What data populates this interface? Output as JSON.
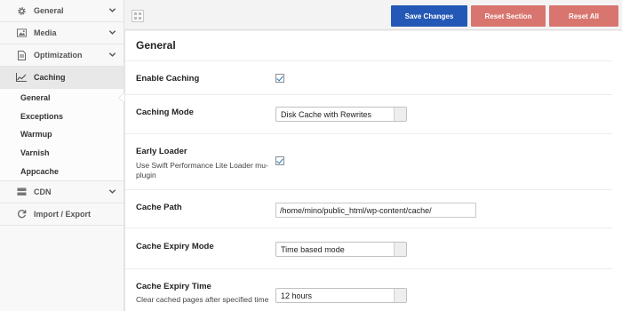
{
  "sidebar": {
    "items": [
      {
        "label": "General",
        "icon": "gear-icon"
      },
      {
        "label": "Media",
        "icon": "image-icon"
      },
      {
        "label": "Optimization",
        "icon": "document-icon"
      },
      {
        "label": "Caching",
        "icon": "chart-icon"
      },
      {
        "label": "CDN",
        "icon": "server-icon"
      },
      {
        "label": "Import / Export",
        "icon": "refresh-icon"
      }
    ],
    "subitems": [
      "General",
      "Exceptions",
      "Warmup",
      "Varnish",
      "Appcache"
    ]
  },
  "toolbar": {
    "save_label": "Save Changes",
    "reset_section_label": "Reset Section",
    "reset_all_label": "Reset All"
  },
  "main": {
    "title": "General",
    "enable_caching": {
      "label": "Enable Caching",
      "checked": true
    },
    "caching_mode": {
      "label": "Caching Mode",
      "value": "Disk Cache with Rewrites"
    },
    "early_loader": {
      "label": "Early Loader",
      "desc": "Use Swift Performance Lite Loader mu-plugin",
      "checked": true
    },
    "cache_path": {
      "label": "Cache Path",
      "value": "/home/mino/public_html/wp-content/cache/"
    },
    "cache_expiry_mode": {
      "label": "Cache Expiry Mode",
      "value": "Time based mode"
    },
    "cache_expiry_time": {
      "label": "Cache Expiry Time",
      "desc": "Clear cached pages after specified time",
      "value": "12 hours"
    }
  },
  "colors": {
    "save_button": "#2458b6",
    "reset_button": "#d8756f",
    "checkbox_tick": "#1e73be"
  }
}
